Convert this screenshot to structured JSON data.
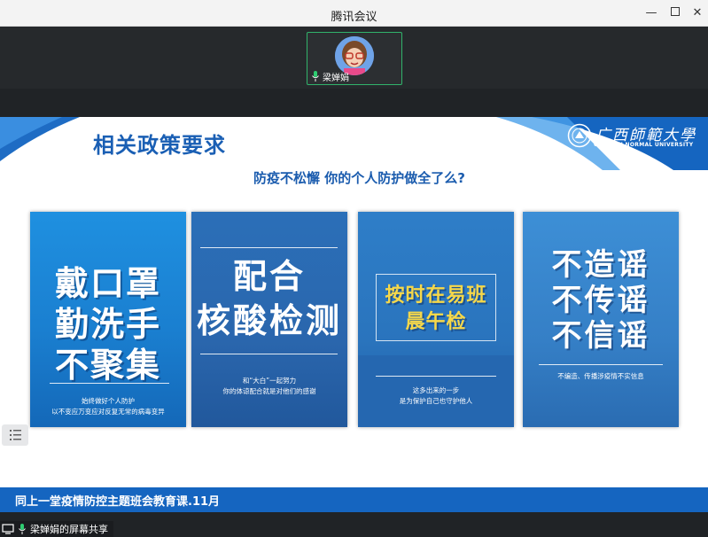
{
  "window": {
    "title": "腾讯会议"
  },
  "participant": {
    "name": "梁婵娟"
  },
  "slide": {
    "title": "相关政策要求",
    "subtitle": "防疫不松懈 你的个人防护做全了么?",
    "logo_cn": "广西師範大學",
    "logo_en": "GUANGXI NORMAL UNIVERSITY",
    "posters": [
      {
        "lines": [
          "戴口罩",
          "勤洗手",
          "不聚集"
        ],
        "caption": [
          "始终做好个人防护",
          "以不变应万变应对反复无常的病毒变异"
        ]
      },
      {
        "lines": [
          "配合",
          "核酸检测"
        ],
        "caption": [
          "和“大白”一起努力",
          "你的体谅配合就是对他们的感谢"
        ]
      },
      {
        "lines": [
          "按时在易班",
          "晨午检"
        ],
        "caption": [
          "这多出来的一步",
          "是为保护自己也守护他人"
        ]
      },
      {
        "lines": [
          "不造谣",
          "不传谣",
          "不信谣"
        ],
        "caption": [
          "不编造、传播涉疫情不实信息"
        ]
      }
    ],
    "footer": "同上一堂疫情防控主题班会教育课.11月"
  },
  "status": {
    "share_text": "梁婵娟的屏幕共享"
  },
  "colors": {
    "accent_blue": "#1565c0",
    "participant_border": "#31b36b"
  },
  "icons": {
    "minimize": "minimize-icon",
    "maximize": "maximize-icon",
    "close": "close-icon",
    "mic": "microphone-icon",
    "list": "list-icon"
  }
}
